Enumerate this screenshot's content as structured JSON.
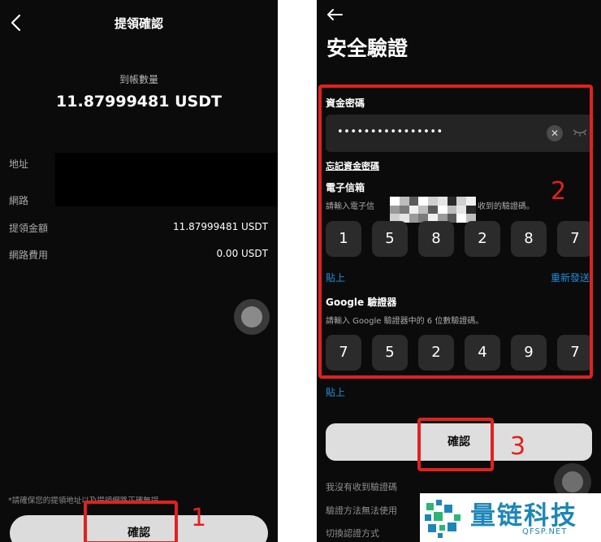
{
  "left_screen": {
    "title": "提領確認",
    "amount_label": "到帳數量",
    "amount_value": "11.87999481 USDT",
    "rows": [
      {
        "label": "地址",
        "value": ""
      },
      {
        "label": "網路",
        "value": ""
      },
      {
        "label": "提領金額",
        "value": "11.87999481 USDT"
      },
      {
        "label": "網路費用",
        "value": "0.00 USDT"
      }
    ],
    "notice": "*請確保您的提領地址以及提領網路正確無誤",
    "confirm_label": "確認"
  },
  "right_screen": {
    "title": "安全驗證",
    "fund_password": {
      "label": "資金密碼",
      "value": "••••••••••••••••",
      "forgot_link": "忘記資金密碼"
    },
    "email": {
      "label": "電子信箱",
      "hint_prefix": "請輸入電子信",
      "hint_suffix": "收到的驗證碼。",
      "digits": [
        "1",
        "5",
        "8",
        "2",
        "8",
        "7"
      ],
      "paste": "貼上",
      "resend": "重新發送"
    },
    "google": {
      "label": "Google 驗證器",
      "hint": "請輸入 Google 驗證器中的 6 位數驗證碼。",
      "digits": [
        "7",
        "5",
        "2",
        "4",
        "9",
        "7"
      ],
      "paste": "貼上"
    },
    "confirm_label": "確認",
    "footer_links": [
      "我沒有收到驗證碼",
      "驗證方法無法使用",
      "切換認證方式"
    ]
  },
  "annotations": {
    "n1": "1",
    "n2": "2",
    "n3": "3"
  },
  "watermark": {
    "title": "量链科技",
    "subtitle": "QFSP.NET"
  },
  "colors": {
    "annotation_red": "#e0221f",
    "link_blue": "#1e8fd6",
    "brand_blue": "#1d86b8",
    "background": "#0b0b0b"
  }
}
